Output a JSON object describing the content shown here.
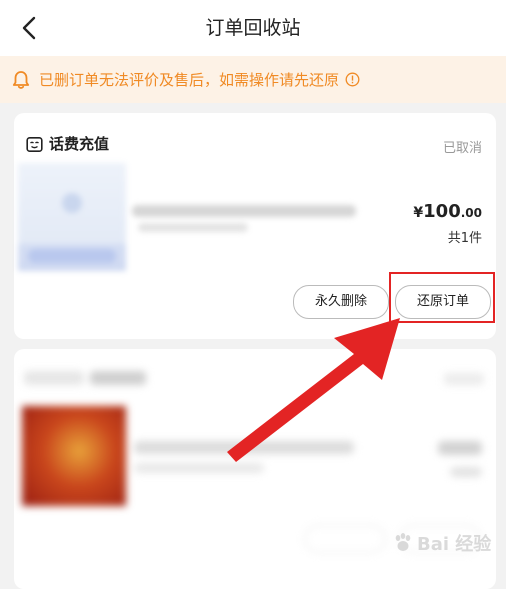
{
  "header": {
    "title": "订单回收站",
    "back_icon": "chevron-left-icon"
  },
  "notice": {
    "text": "已删订单无法评价及售后，如需操作请先还原",
    "color": "#f08a24",
    "bell_icon": "bell-icon",
    "info_icon": "info-circle-icon"
  },
  "order": {
    "shop_name": "话费充值",
    "shop_icon": "store-icon",
    "status": "已取消",
    "price_currency": "¥",
    "price_integer": "100",
    "price_decimal": ".00",
    "quantity": "共1件",
    "delete_label": "永久删除",
    "restore_label": "还原订单"
  },
  "annotation": {
    "color": "#e32424",
    "target": "还原订单"
  },
  "watermark": {
    "text": "Bai 经验"
  }
}
